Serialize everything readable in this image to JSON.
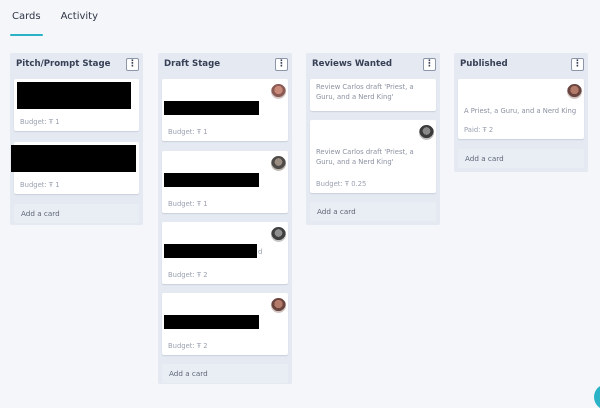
{
  "tabs": [
    {
      "label": "Cards",
      "active": true
    },
    {
      "label": "Activity",
      "active": false
    }
  ],
  "menu_symbol": "⋮",
  "columns": [
    {
      "title": "Pitch/Prompt Stage",
      "cards": [
        {
          "meta": "Budget: Ŧ 1"
        },
        {
          "meta": "Budget: Ŧ 1"
        }
      ],
      "add_label": "Add a card"
    },
    {
      "title": "Draft Stage",
      "cards": [
        {
          "meta": "Budget: Ŧ 1"
        },
        {
          "meta": "Budget: Ŧ 1"
        },
        {
          "meta": "Budget: Ŧ 2",
          "trailing": "d"
        },
        {
          "meta": "Budget: Ŧ 2"
        }
      ],
      "add_label": "Add a card"
    },
    {
      "title": "Reviews Wanted",
      "cards": [
        {
          "desc": "Review Carlos draft 'Priest, a Guru, and a Nerd King'"
        },
        {
          "desc": "Review Carlos draft 'Priest, a Guru, and a Nerd King'",
          "meta": "Budget: Ŧ 0.25"
        }
      ],
      "add_label": "Add a card"
    },
    {
      "title": "Published",
      "cards": [
        {
          "desc": "A Priest, a Guru, and a Nerd King",
          "meta": "Paid: Ŧ 2"
        }
      ],
      "add_label": "Add a card"
    }
  ],
  "colors": {
    "accent": "#2ab3c6",
    "column_bg": "#e4e9f2",
    "page_bg": "#f4f6f9"
  }
}
